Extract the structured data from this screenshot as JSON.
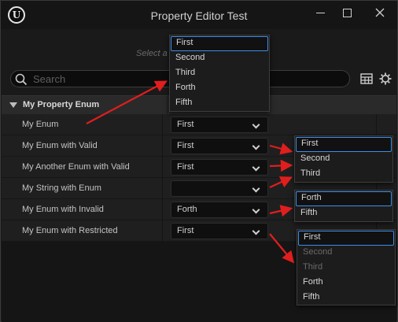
{
  "window": {
    "title": "Property Editor Test",
    "logo_letter": "U",
    "buttons": {
      "minimize": "minimize",
      "maximize": "maximize",
      "close": "close"
    }
  },
  "hint": "Select a",
  "search": {
    "placeholder": "Search"
  },
  "category": {
    "label": "My Property Enum"
  },
  "rows": [
    {
      "label": "My Enum",
      "value": "First"
    },
    {
      "label": "My Enum with Valid",
      "value": "First"
    },
    {
      "label": "My Another Enum with Valid",
      "value": "First"
    },
    {
      "label": "My String with Enum",
      "value": ""
    },
    {
      "label": "My Enum with Invalid",
      "value": "Forth"
    },
    {
      "label": "My Enum with Restricted",
      "value": "First"
    }
  ],
  "popups": {
    "my_enum": {
      "items": [
        {
          "label": "First",
          "state": "selected"
        },
        {
          "label": "Second",
          "state": "normal"
        },
        {
          "label": "Third",
          "state": "normal"
        },
        {
          "label": "Forth",
          "state": "normal"
        },
        {
          "label": "Fifth",
          "state": "normal"
        }
      ]
    },
    "with_valid": {
      "items": [
        {
          "label": "First",
          "state": "selected"
        },
        {
          "label": "Second",
          "state": "normal"
        },
        {
          "label": "Third",
          "state": "normal"
        }
      ]
    },
    "with_invalid": {
      "items": [
        {
          "label": "Forth",
          "state": "selected"
        },
        {
          "label": "Fifth",
          "state": "normal"
        }
      ]
    },
    "with_restricted": {
      "items": [
        {
          "label": "First",
          "state": "selected"
        },
        {
          "label": "Second",
          "state": "disabled"
        },
        {
          "label": "Third",
          "state": "disabled"
        },
        {
          "label": "Forth",
          "state": "normal"
        },
        {
          "label": "Fifth",
          "state": "normal"
        }
      ]
    }
  },
  "colors": {
    "accent_selection": "#3e8de6",
    "annotation_arrow": "#e01e1e"
  }
}
